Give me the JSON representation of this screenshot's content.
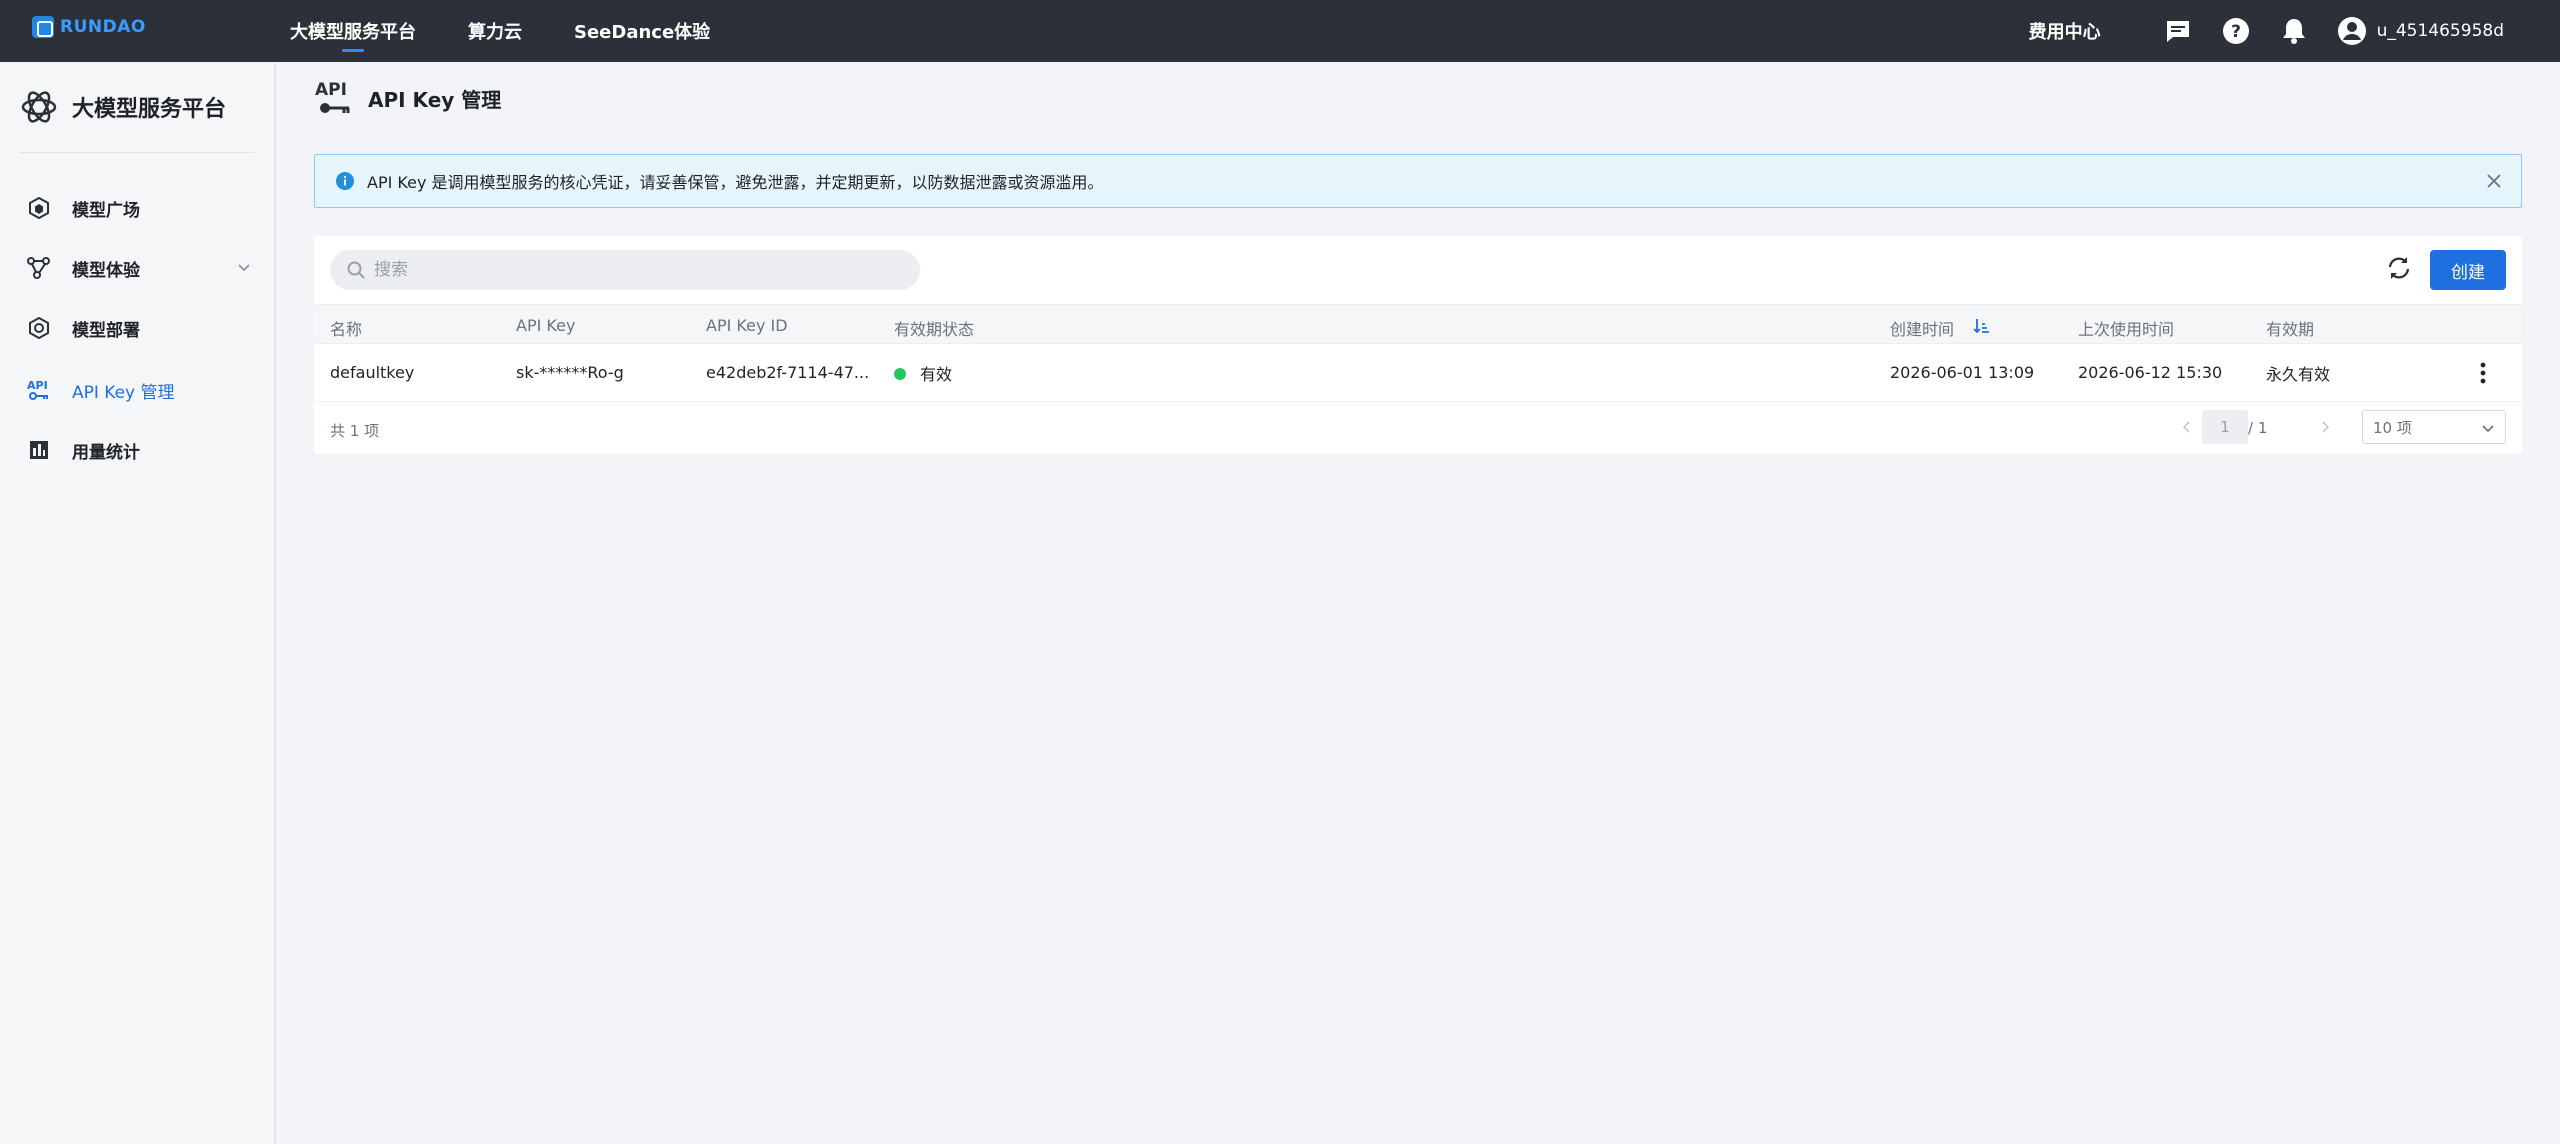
{
  "topbar": {
    "logo_text": "RUNDAO",
    "nav": [
      "大模型服务平台",
      "算力云",
      "SeeDance体验"
    ],
    "fee_center": "费用中心",
    "username": "u_451465958d"
  },
  "sidebar": {
    "brand_title": "大模型服务平台",
    "items": [
      {
        "label": "模型广场",
        "icon": "hexagon-icon"
      },
      {
        "label": "模型体验",
        "icon": "molecule-icon"
      },
      {
        "label": "模型部署",
        "icon": "deploy-icon"
      },
      {
        "label": "API Key 管理",
        "icon": "api-key-icon"
      },
      {
        "label": "用量统计",
        "icon": "bar-chart-icon"
      }
    ]
  },
  "page": {
    "title": "API Key 管理",
    "title_icon_text": "API"
  },
  "alert": {
    "text": "API Key 是调用模型服务的核心凭证，请妥善保管，避免泄露，并定期更新，以防数据泄露或资源滥用。"
  },
  "toolbar": {
    "search_placeholder": "搜索",
    "create_label": "创建"
  },
  "table": {
    "columns": [
      "名称",
      "API Key",
      "API Key ID",
      "有效期状态",
      "创建时间",
      "上次使用时间",
      "有效期"
    ],
    "rows": [
      {
        "name": "defaultkey",
        "api_key": "sk-******Ro-g",
        "api_key_id": "e42deb2f-7114-47...",
        "status": "有效",
        "created": "2026-06-01 13:09",
        "last_used": "2026-06-12 15:30",
        "validity": "永久有效"
      }
    ]
  },
  "pagination": {
    "total": "共 1 项",
    "current": "1",
    "of_total": "/ 1",
    "page_size": "10 项"
  },
  "colors": {
    "topbar_bg": "#2c3038",
    "accent": "#1f6fe0",
    "status_green": "#22c55e",
    "alert_bg": "#e6f4fb"
  }
}
